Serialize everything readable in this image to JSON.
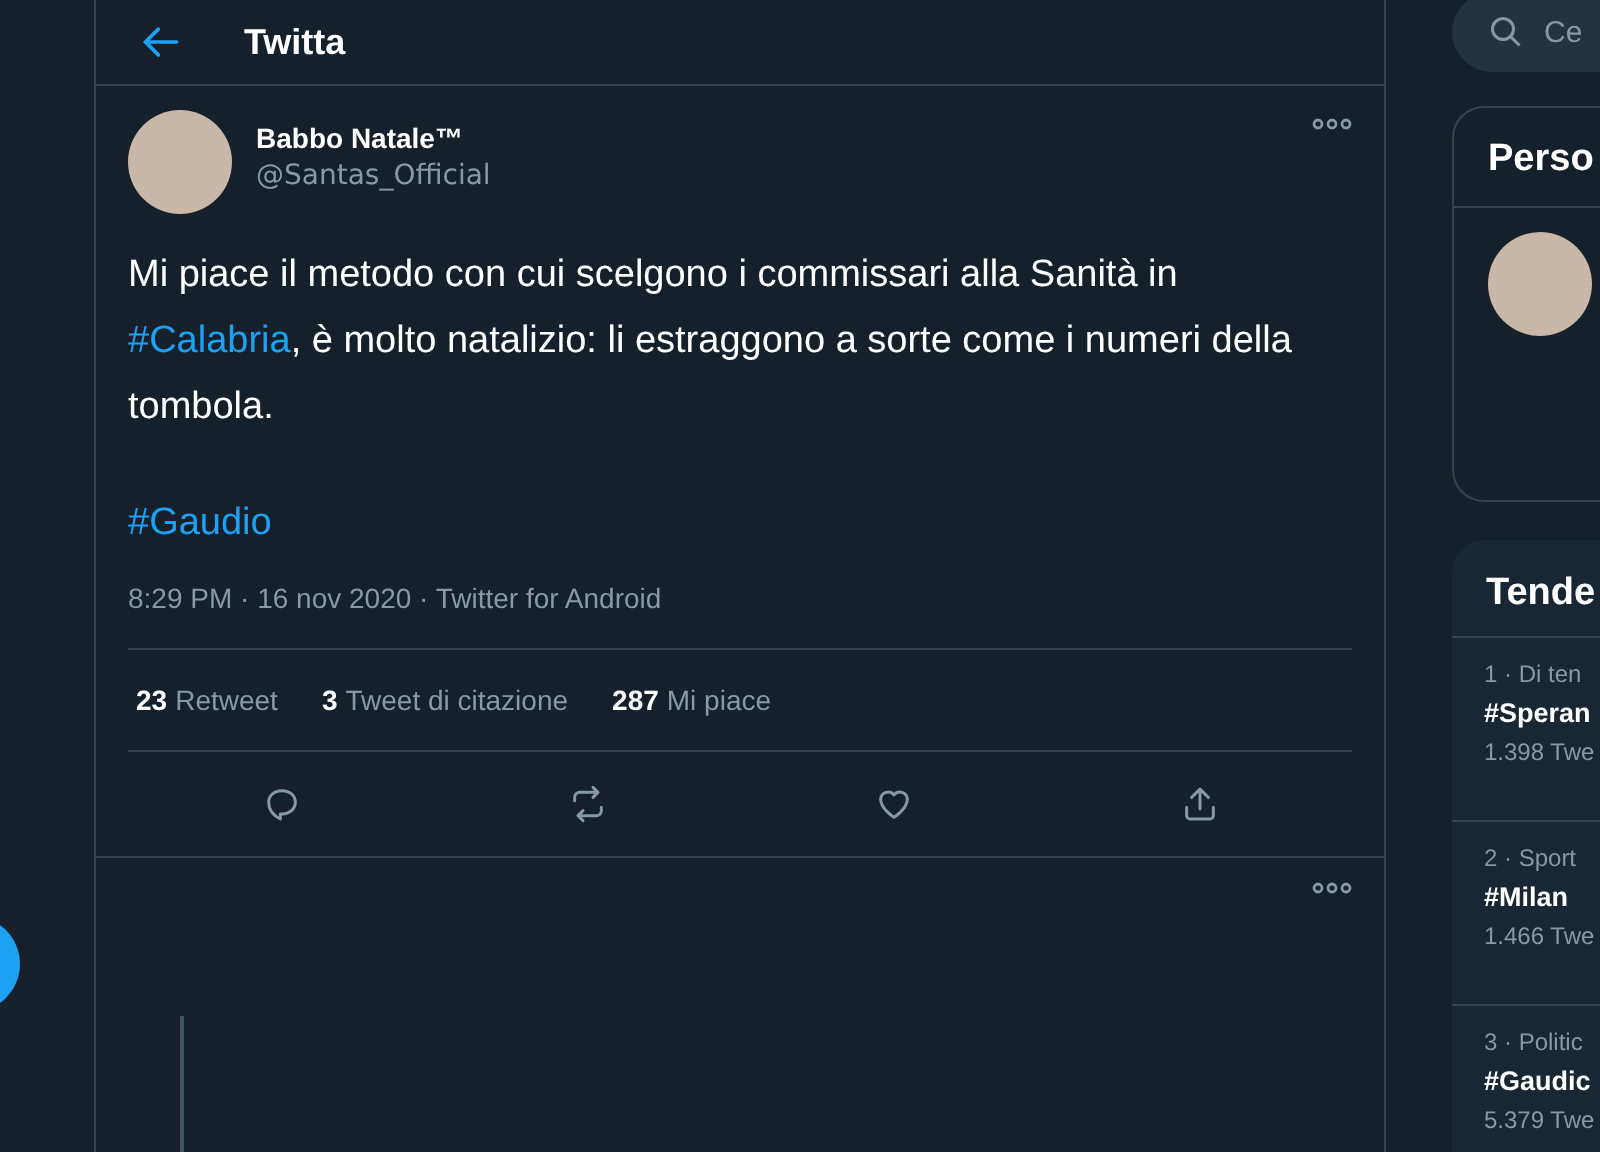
{
  "header": {
    "title": "Twitta"
  },
  "tweet": {
    "name": "Babbo Natale™",
    "handle": "@Santas_Official",
    "text": [
      {
        "kind": "plain",
        "text": "Mi piace il metodo con cui scelgono i commissari alla Sanità in "
      },
      {
        "kind": "hashtag",
        "text": "#Calabria"
      },
      {
        "kind": "plain",
        "text": ", è molto natalizio: li estraggono a sorte come i numeri della tombola."
      }
    ],
    "hashtag": "#Gaudio",
    "meta": "8:29 PM · 16 nov 2020 · Twitter for Android",
    "stats": [
      {
        "count": "23",
        "label": "Retweet"
      },
      {
        "count": "3",
        "label": "Tweet di citazione"
      },
      {
        "count": "287",
        "label": "Mi piace"
      }
    ]
  },
  "search": {
    "placeholder": "Ce"
  },
  "who_to_follow": {
    "title": "Perso"
  },
  "trends": {
    "title": "Tende",
    "items": [
      {
        "context": "1 · Di ten",
        "name": "#Speran",
        "count": "1.398 Twe"
      },
      {
        "context": "2 · Sport",
        "name": "#Milan",
        "count": "1.466 Twe"
      },
      {
        "context": "3 · Politic",
        "name": "#Gaudic",
        "count": "5.379 Twe"
      }
    ]
  }
}
